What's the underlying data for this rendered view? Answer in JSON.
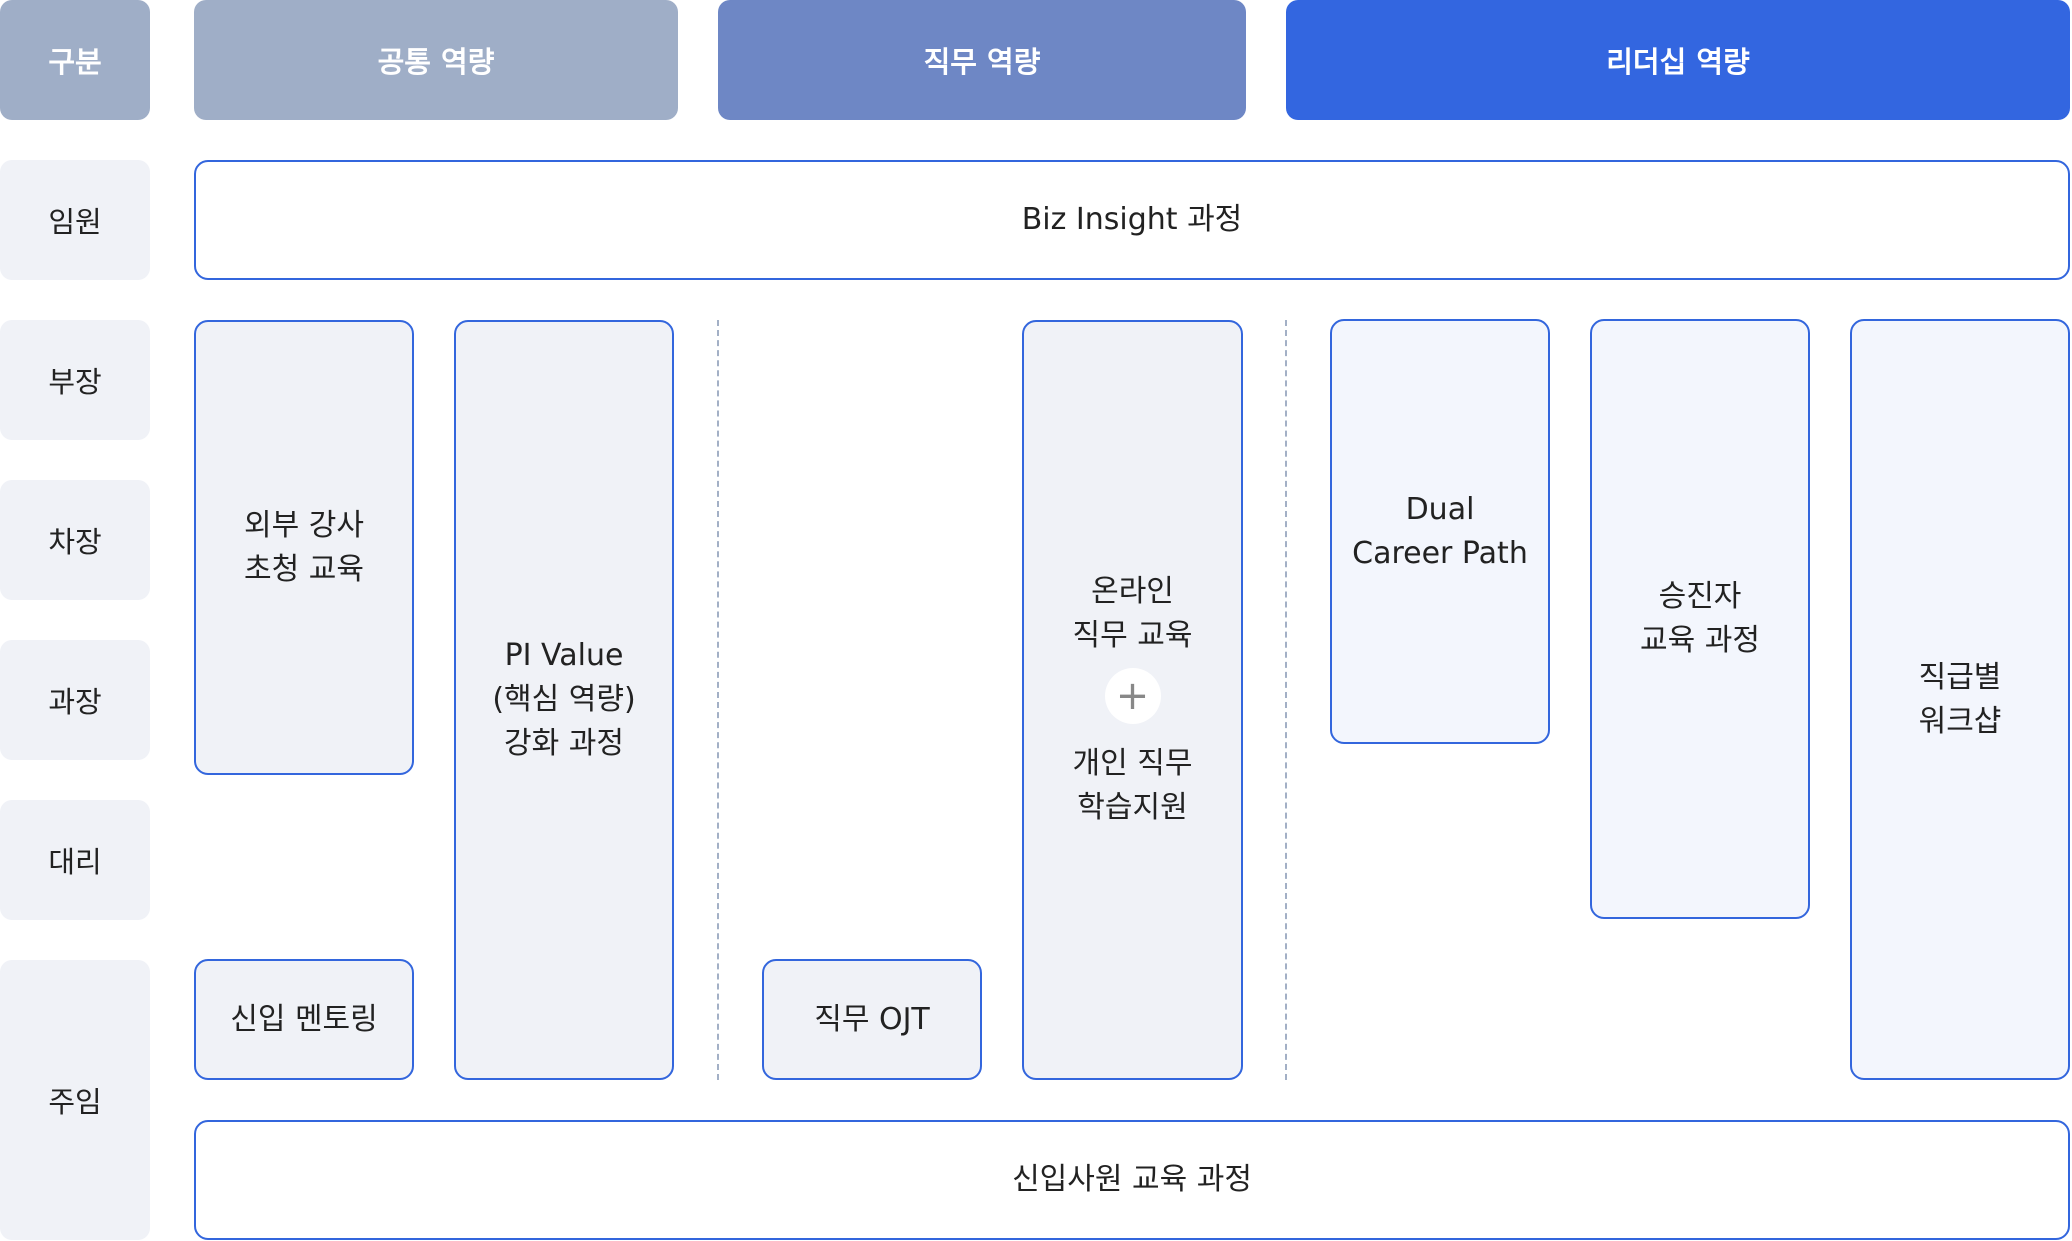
{
  "headers": {
    "category": "구분",
    "common": "공통 역량",
    "job": "직무 역량",
    "leadership": "리더십 역량"
  },
  "colors": {
    "category_header": "#9faec7",
    "common_header": "#9faec7",
    "job_header": "#6e87c5",
    "leadership_header": "#3366e0",
    "box_border": "#3366dd",
    "box_fill": "#f0f2f7",
    "row_label_fill": "#f0f2f7"
  },
  "rows": [
    "임원",
    "부장",
    "차장",
    "과장",
    "대리",
    "주임"
  ],
  "programs": {
    "biz_insight": "Biz Insight 과정",
    "external_lecture": [
      "외부 강사",
      "초청 교육"
    ],
    "pi_value": [
      "PI Value",
      "(핵심 역량)",
      "강화 과정"
    ],
    "new_mentoring": "신입 멘토링",
    "job_ojt": "직무 OJT",
    "online_job": [
      "온라인",
      "직무 교육"
    ],
    "plus": "+",
    "personal_job": [
      "개인 직무",
      "학습지원"
    ],
    "dual_career": [
      "Dual",
      "Career Path"
    ],
    "promotion": [
      "승진자",
      "교육 과정"
    ],
    "rank_workshop": [
      "직급별",
      "워크샵"
    ],
    "new_hire": "신입사원 교육 과정"
  }
}
